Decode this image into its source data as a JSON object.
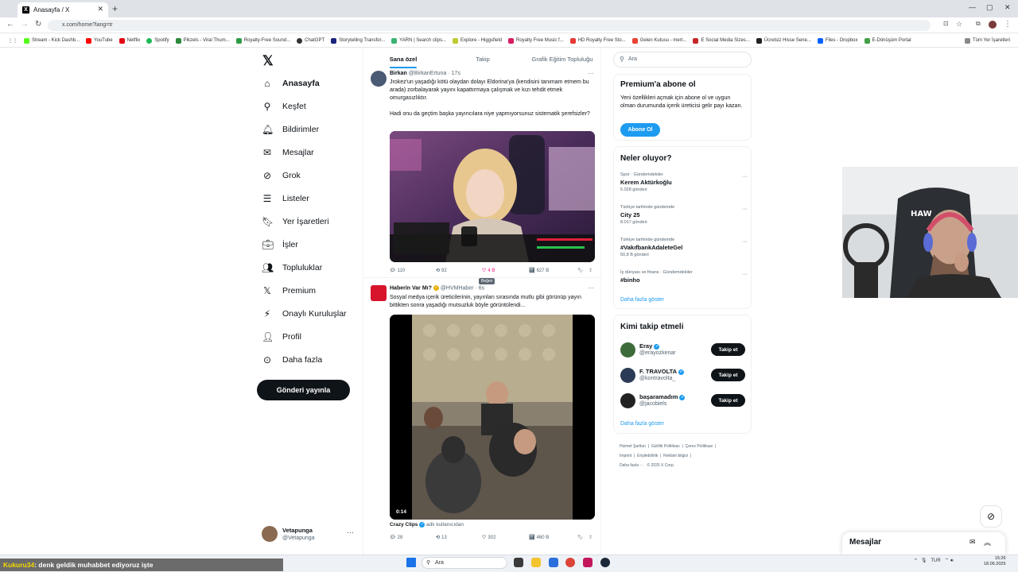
{
  "browser": {
    "tab_title": "Anasayfa / X",
    "url": "x.com/home?lang=tr",
    "bookmarks": [
      "Stream - Kick Dashb...",
      "YouTube",
      "Netflix",
      "Spotify",
      "Pikzels - Viral Thum...",
      "Royalty-Free Sound...",
      "ChatGPT",
      "Storytelling Transfor...",
      "YARN | Search clips...",
      "Explore - Higgsfield",
      "Royalty Free Music f...",
      "HD Royalty Free Sto...",
      "Gelen Kutusu - mert...",
      "E Social Media Sizes...",
      "Ücretsiz Hisse Sene...",
      "Files - Dropbox",
      "E-Dönüşüm Portal"
    ],
    "all_bookmarks": "Tüm Yer İşaretleri"
  },
  "nav": {
    "items": [
      {
        "label": "Anasayfa",
        "icon": "home-icon"
      },
      {
        "label": "Keşfet",
        "icon": "search-icon"
      },
      {
        "label": "Bildirimler",
        "icon": "bell-icon"
      },
      {
        "label": "Mesajlar",
        "icon": "mail-icon"
      },
      {
        "label": "Grok",
        "icon": "grok-icon"
      },
      {
        "label": "Listeler",
        "icon": "list-icon"
      },
      {
        "label": "Yer İşaretleri",
        "icon": "bookmark-icon"
      },
      {
        "label": "İşler",
        "icon": "briefcase-icon"
      },
      {
        "label": "Topluluklar",
        "icon": "people-icon"
      },
      {
        "label": "Premium",
        "icon": "x-icon"
      },
      {
        "label": "Onaylı Kuruluşlar",
        "icon": "lightning-icon"
      },
      {
        "label": "Profil",
        "icon": "person-icon"
      },
      {
        "label": "Daha fazla",
        "icon": "more-icon"
      }
    ],
    "post_button": "Gönderi yayınla",
    "account": {
      "name": "Vetapunga",
      "handle": "@Vetapunga"
    }
  },
  "feed": {
    "tabs": [
      "Sana özel",
      "Takip",
      "Grafik Eğitim Topluluğu"
    ],
    "tweet1": {
      "name": "Birkan",
      "handle": "@BirkanErtuna · 17s",
      "text1": "Jrokez'un yaşadığı kötü olaydan dolayı Eldorina'ya (kendisini tanımam etmem bu arada) zorbalayarak yayını kapattırmaya çalışmak ve kızı tehdit etmek omurgasızlıktır.",
      "text2": "Hadi onu da geçtim başka yayıncılara niye yapmıyorsunuz sistematik şerefsizler?",
      "replies": "110",
      "reposts": "92",
      "likes": "4 B",
      "views": "627 B",
      "tooltip": "Beğen"
    },
    "tweet2": {
      "name": "Haberin Var Mı?",
      "handle": "@HVMHaber · 6s",
      "text": "Sosyal medya içerik üreticilerinin, yayınları sırasında mutlu gibi görünüp yayın bittikten sonra yaşadığı mutsuzluk böyle görüntülendi...",
      "duration": "0:14",
      "source_name": "Crazy Clips",
      "source_suffix": "adlı kullanıcıdan",
      "replies": "28",
      "reposts": "13",
      "likes": "302",
      "views": "460 B"
    }
  },
  "right": {
    "search_placeholder": "Ara",
    "premium": {
      "title": "Premium'a abone ol",
      "text": "Yeni özellikleri açmak için abone ol ve uygun olman durumunda içerik üreticisi gelir payı kazan.",
      "button": "Abone Ol"
    },
    "trends_title": "Neler oluyor?",
    "trends": [
      {
        "category": "Spor · Gündemdekiler",
        "name": "Kerem Aktürkoğlu",
        "count": "5.028 gönderi"
      },
      {
        "category": "Türkiye tarihinde gündemde",
        "name": "City 25",
        "count": "8.017 gönderi"
      },
      {
        "category": "Türkiye tarihinde gündemde",
        "name": "#VakıfbankAdaletеGel",
        "count": "50,8 B gönderi"
      },
      {
        "category": "İş dünyası ve finans · Gündemdekiler",
        "name": "#binho",
        "count": ""
      }
    ],
    "show_more": "Daha fazla göster",
    "follow_title": "Kimi takip etmeli",
    "follows": [
      {
        "name": "Eray",
        "handle": "@erayozkenar",
        "button": "Takip et"
      },
      {
        "name": "F. TRAVOLTA",
        "handle": "@kontravolta_",
        "button": "Takip et"
      },
      {
        "name": "başaramadım",
        "handle": "@jacobiels",
        "button": "Takip et"
      }
    ],
    "footer": [
      "Hizmet Şartları",
      "Gizlilik Politikası",
      "Çerez Politikası",
      "Imprint",
      "Erişilebilirlik",
      "Reklam bilgisi",
      "Daha fazla ···",
      "© 2025 X Corp."
    ]
  },
  "messages_drawer": "Mesajlar",
  "taskbar": {
    "ticker_user": "Kukuru34",
    "ticker_text": ": denk geldik muhabbet ediyoruz işte",
    "search": "Ara",
    "lang": "TUR",
    "time": "15:26",
    "date": "18.06.2025"
  },
  "colors": {
    "accent": "#1d9bf0",
    "text": "#0f1419",
    "muted": "#536471"
  }
}
